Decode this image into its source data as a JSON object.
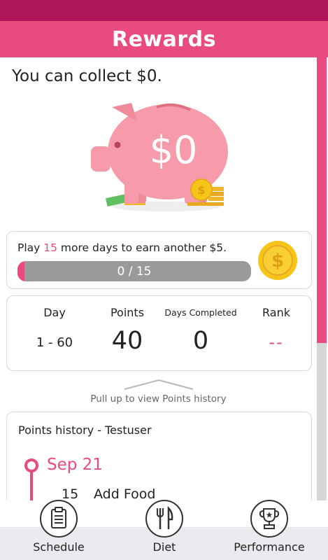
{
  "header": {
    "title": "Rewards"
  },
  "summary": {
    "collect_text": "You can collect $0.",
    "piggy_amount": "$0"
  },
  "goal": {
    "prefix": "Play ",
    "days_remaining": "15",
    "suffix": " more days to earn another $5.",
    "progress_text": "0 / 15",
    "progress_fraction": 0.03,
    "coin_symbol": "$"
  },
  "stats": {
    "day_label": "Day",
    "day_value": "1 - 60",
    "points_label": "Points",
    "points_value": "40",
    "days_completed_label": "Days Completed",
    "days_completed_value": "0",
    "rank_label": "Rank",
    "rank_value": "--"
  },
  "pull_hint": "Pull up to view Points history",
  "history": {
    "title": "Points history - Testuser",
    "entries": [
      {
        "date": "Sep 21",
        "points": "15",
        "label": "Add Food"
      }
    ]
  },
  "tabs": [
    {
      "label": "Schedule",
      "icon": "clipboard-icon"
    },
    {
      "label": "Diet",
      "icon": "fork-knife-icon"
    },
    {
      "label": "Performance",
      "icon": "trophy-icon"
    }
  ],
  "colors": {
    "accent": "#ea4b7f",
    "status_bar": "#b0175a",
    "progress_track": "#9a9a9a",
    "coin": "#f5c518"
  }
}
